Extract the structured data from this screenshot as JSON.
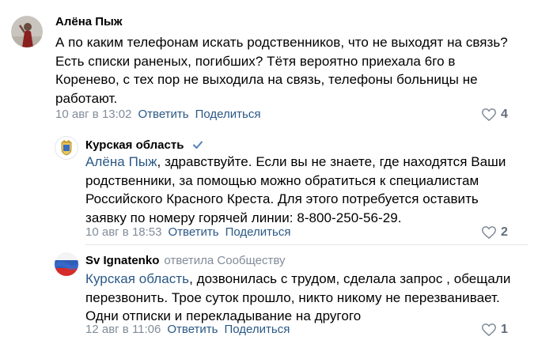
{
  "comments": [
    {
      "author": "Алёна Пыж",
      "text": "А по каким телефонам искать родственников, что не выходят на связь? Есть списки раненых, погибших? Тётя вероятно приехала 6го в Кореневo, с тех пор не выходила на связь, телефоны больницы не работают.",
      "date": "10 авг в 13:02",
      "reply_label": "Ответить",
      "share_label": "Поделиться",
      "likes": "4"
    },
    {
      "author": "Курская область",
      "mention": "Алёна Пыж",
      "text": ", здравствуйте. Если вы не знаете, где находятся Ваши родственники, за помощью можно обратиться к специалистам Российского Красного Креста. Для этого потребуется оставить заявку по номеру горячей линии: 8-800-250-56-29.",
      "date": "10 авг в 18:53",
      "reply_label": "Ответить",
      "share_label": "Поделиться",
      "likes": "2"
    },
    {
      "author": "Sv Ignatenko",
      "reply_to": "ответила Сообществу",
      "mention": "Курская область",
      "text": ", дозвонилась с трудом, сделала запрос , обещали перезвонить. Трое суток прошло, никто никому не перезванивает. Одни отписки и перекладывание на другого",
      "date": "12 авг в 11:06",
      "reply_label": "Ответить",
      "share_label": "Поделиться",
      "likes": "1"
    }
  ],
  "icons": {
    "like": "heart-outline-icon",
    "verified": "verified-check-icon"
  },
  "colors": {
    "link": "#2a5885",
    "meta": "#818c99",
    "verified": "#5181b8"
  }
}
